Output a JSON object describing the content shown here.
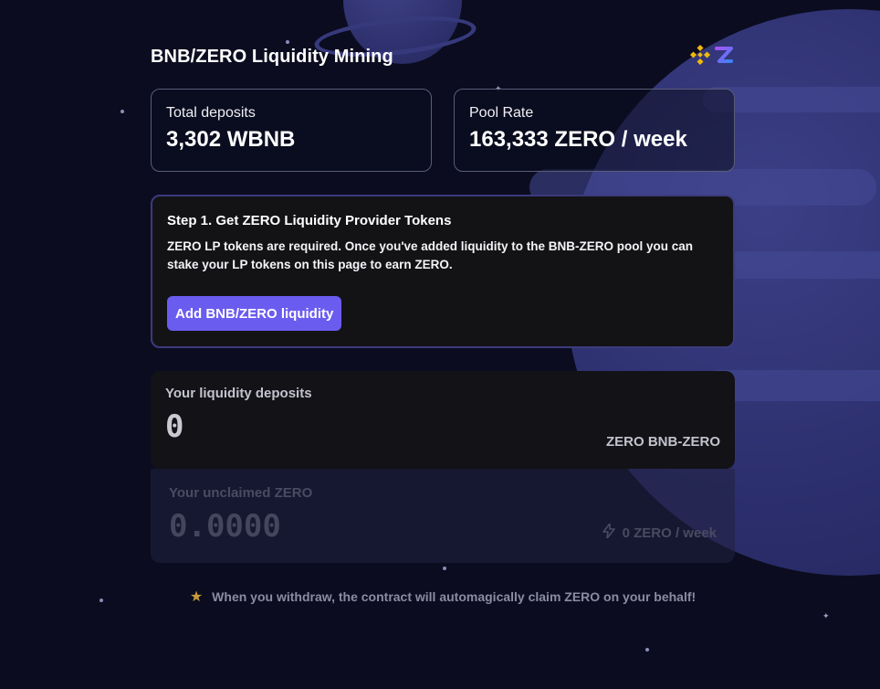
{
  "page": {
    "title": "BNB/ZERO Liquidity Mining",
    "logo_icons": [
      "binance-icon",
      "zero-icon"
    ]
  },
  "stats": {
    "total_deposits": {
      "label": "Total deposits",
      "value": "3,302 WBNB"
    },
    "pool_rate": {
      "label": "Pool Rate",
      "value": "163,333 ZERO / week"
    }
  },
  "step": {
    "title": "Step 1. Get ZERO Liquidity Provider Tokens",
    "text": "ZERO LP tokens are required. Once you've added liquidity to the BNB-ZERO pool you can stake your LP tokens on this page to earn ZERO.",
    "button_label": "Add BNB/ZERO liquidity"
  },
  "deposits": {
    "label": "Your liquidity deposits",
    "value": "0",
    "unit": "ZERO BNB-ZERO"
  },
  "unclaimed": {
    "label": "Your unclaimed ZERO",
    "value": "0.0000",
    "rate_icon": "lightning-icon",
    "rate": "0 ZERO / week"
  },
  "notice": {
    "icon": "star-icon",
    "text": "When you withdraw, the contract will automagically claim ZERO on your behalf!"
  },
  "colors": {
    "background": "#0b0c1f",
    "accent": "#6b5cf0",
    "binance_yellow": "#f0b90b",
    "zero_gradient_start": "#8b5cf6",
    "zero_gradient_end": "#3b82f6"
  }
}
